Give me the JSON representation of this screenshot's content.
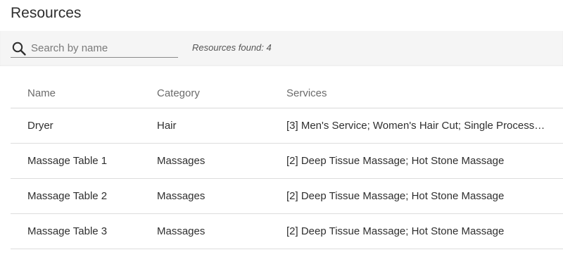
{
  "header": {
    "title": "Resources"
  },
  "search": {
    "placeholder": "Search by name",
    "value": ""
  },
  "results": {
    "label": "Resources found: 4"
  },
  "table": {
    "columns": [
      "Name",
      "Category",
      "Services"
    ],
    "rows": [
      {
        "name": "Dryer",
        "category": "Hair",
        "services": "[3] Men's Service; Women's Hair Cut; Single Process O..."
      },
      {
        "name": "Massage Table 1",
        "category": "Massages",
        "services": "[2] Deep Tissue Massage; Hot Stone Massage"
      },
      {
        "name": "Massage Table 2",
        "category": "Massages",
        "services": "[2] Deep Tissue Massage; Hot Stone Massage"
      },
      {
        "name": "Massage Table 3",
        "category": "Massages",
        "services": "[2] Deep Tissue Massage; Hot Stone Massage"
      }
    ]
  },
  "icons": {
    "search": "search-icon"
  },
  "colors": {
    "toolbar_bg": "#f5f5f5",
    "divider": "#dddddd",
    "header_text": "#6b6b6b"
  }
}
